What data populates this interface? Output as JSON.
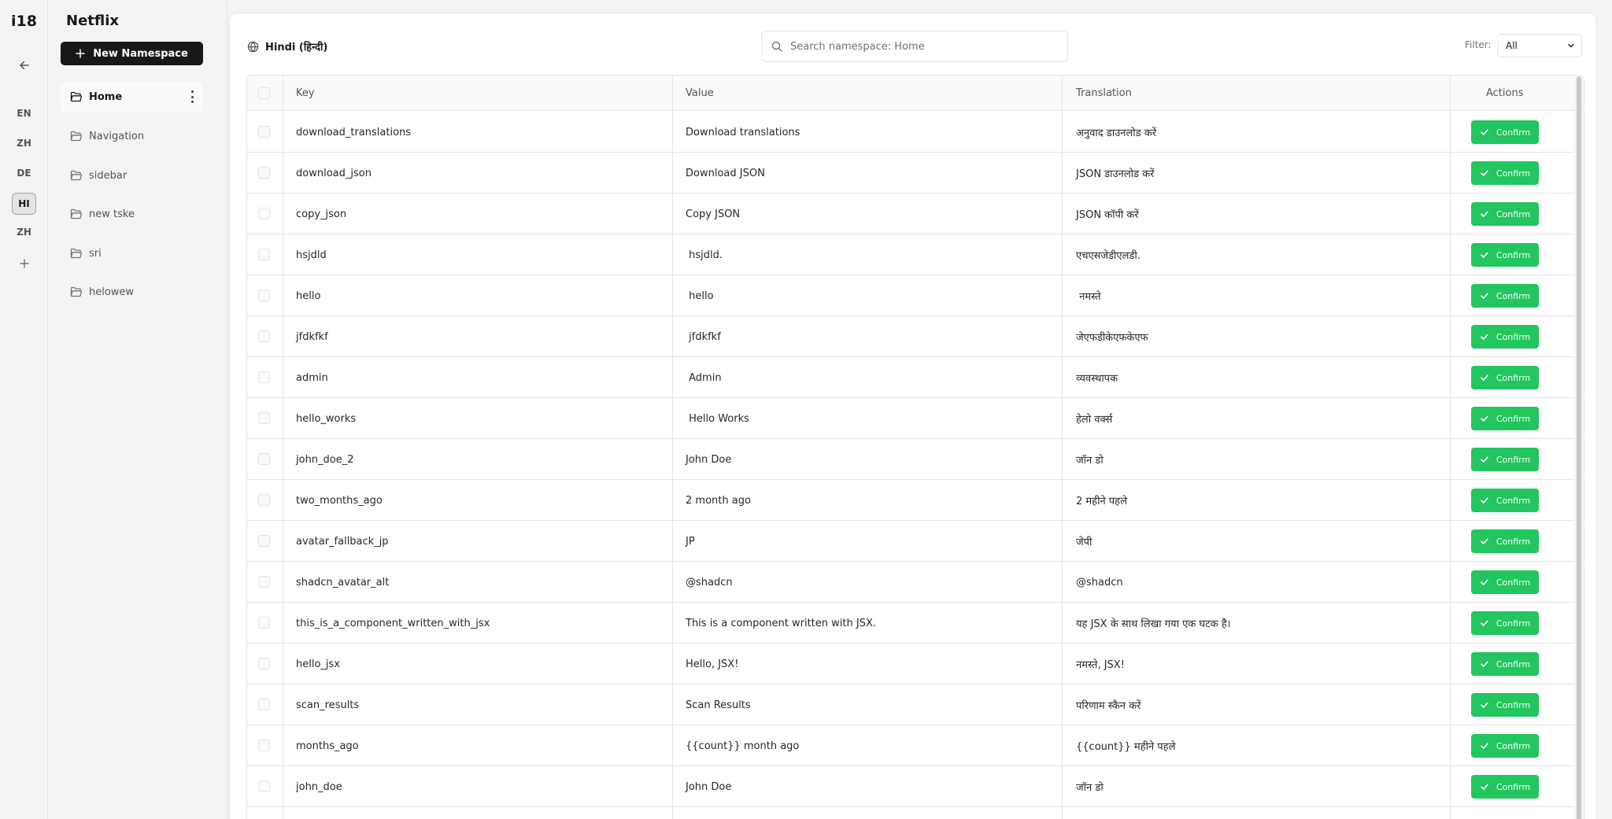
{
  "rail": {
    "logo": "i18",
    "languages": [
      {
        "code": "EN",
        "active": false
      },
      {
        "code": "ZH",
        "active": false
      },
      {
        "code": "DE",
        "active": false
      },
      {
        "code": "HI",
        "active": true
      },
      {
        "code": "ZH",
        "active": false
      }
    ]
  },
  "sidebar": {
    "project_name": "Netflix",
    "new_namespace_label": "New Namespace",
    "namespaces": [
      {
        "label": "Home",
        "active": true
      },
      {
        "label": "Navigation",
        "active": false
      },
      {
        "label": "sidebar",
        "active": false
      },
      {
        "label": "new tske",
        "active": false
      },
      {
        "label": "sri",
        "active": false
      },
      {
        "label": "helowew",
        "active": false
      }
    ]
  },
  "main": {
    "language_label": "Hindi (हिन्दी)",
    "search_placeholder": "Search namespace: Home",
    "filter_label": "Filter:",
    "filter_value": "All",
    "columns": {
      "key": "Key",
      "value": "Value",
      "translation": "Translation",
      "actions": "Actions"
    },
    "confirm_label": "Confirm",
    "rows": [
      {
        "key": "download_translations",
        "value": "Download translations",
        "translation": "अनुवाद डाउनलोड करें"
      },
      {
        "key": "download_json",
        "value": "Download JSON",
        "translation": "JSON डाउनलोड करें"
      },
      {
        "key": "copy_json",
        "value": "Copy JSON",
        "translation": "JSON कॉपी करें"
      },
      {
        "key": "hsjdld",
        "value": " hsjdld.",
        "translation": "एचएसजेडीएलडी."
      },
      {
        "key": "hello",
        "value": " hello",
        "translation": " नमस्ते"
      },
      {
        "key": "jfdkfkf",
        "value": " jfdkfkf",
        "translation": "जेएफडीकेएफकेएफ"
      },
      {
        "key": "admin",
        "value": " Admin",
        "translation": "व्यवस्थापक"
      },
      {
        "key": "hello_works",
        "value": " Hello Works",
        "translation": "हेलो वर्क्स"
      },
      {
        "key": "john_doe_2",
        "value": "John Doe",
        "translation": "जॉन डो"
      },
      {
        "key": "two_months_ago",
        "value": "2 month ago",
        "translation": "2 महीने पहले"
      },
      {
        "key": "avatar_fallback_jp",
        "value": "JP",
        "translation": "जेपी"
      },
      {
        "key": "shadcn_avatar_alt",
        "value": "@shadcn",
        "translation": "@shadcn"
      },
      {
        "key": "this_is_a_component_written_with_jsx",
        "value": "This is a component written with JSX.",
        "translation": "यह JSX के साथ लिखा गया एक घटक है।"
      },
      {
        "key": "hello_jsx",
        "value": "Hello, JSX!",
        "translation": "नमस्ते, JSX!"
      },
      {
        "key": "scan_results",
        "value": "Scan Results",
        "translation": "परिणाम स्कैन करें"
      },
      {
        "key": "months_ago",
        "value": "{{count}} month ago",
        "translation": "{{count}} महीने पहले"
      },
      {
        "key": "john_doe",
        "value": "John Doe",
        "translation": "जॉन डो"
      }
    ]
  }
}
